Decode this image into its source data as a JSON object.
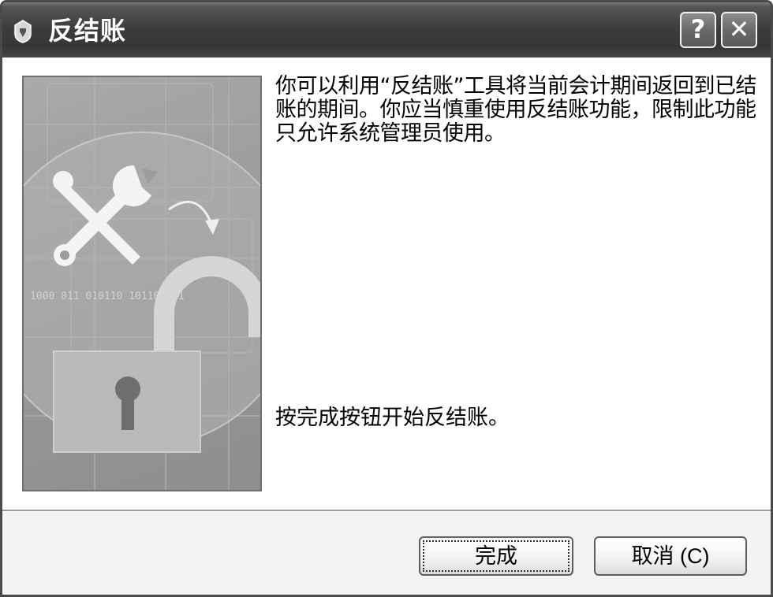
{
  "window": {
    "title": "反结账",
    "help_label": "?",
    "close_label": "✕"
  },
  "content": {
    "description": "你可以利用“反结账”工具将当前会计期间返回到已结账的期间。你应当慎重使用反结账功能，限制此功能只允许系统管理员使用。",
    "instruction": "按完成按钮开始反结账。"
  },
  "buttons": {
    "finish_label": "完成",
    "cancel_label": "取消 (C)"
  },
  "icons": {
    "app": "app-icon",
    "tools": "wrench-screwdriver-icon",
    "arrow": "curved-arrow-icon",
    "padlock": "open-padlock-icon"
  },
  "colors": {
    "titlebar": "#3e3e3e",
    "content_bg": "#ffffff",
    "footer_bg": "#f3f3f3"
  }
}
